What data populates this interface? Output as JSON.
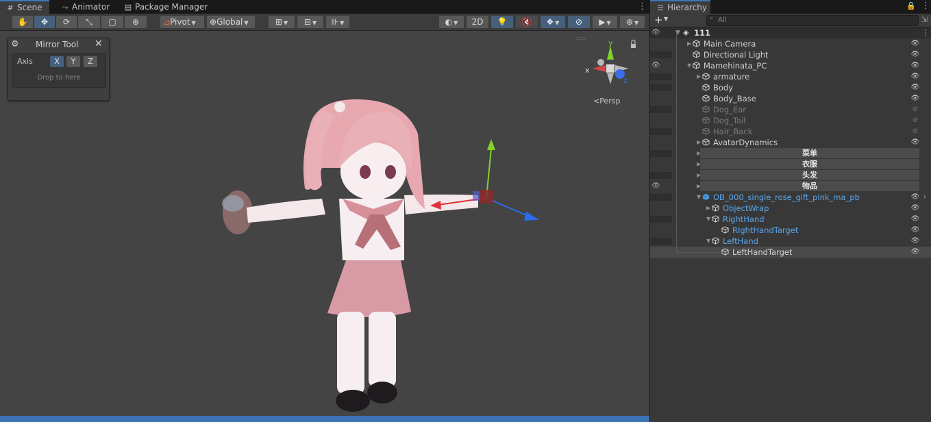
{
  "tabs": {
    "scene": "Scene",
    "animator": "Animator",
    "package_manager": "Package Manager",
    "hierarchy": "Hierarchy"
  },
  "toolbar": {
    "pivot": "Pivot",
    "global": "Global",
    "mode_2d": "2D"
  },
  "scene": {
    "persp_label": "Persp",
    "gizmo_axes": {
      "x": "x",
      "y": "y",
      "z": "z"
    }
  },
  "mirror_tool": {
    "title": "Mirror Tool",
    "axis_label": "Axis",
    "axes": [
      "X",
      "Y",
      "Z"
    ],
    "selected_axis": "X",
    "drop_hint": "Drop to here"
  },
  "hierarchy": {
    "search_placeholder": "All",
    "scene_name": "111",
    "items": [
      {
        "label": "Main Camera",
        "state": "normal",
        "visible": true
      },
      {
        "label": "Directional Light",
        "state": "normal",
        "visible": true
      },
      {
        "label": "Mamehinata_PC",
        "state": "normal",
        "visible": true
      },
      {
        "label": "armature",
        "state": "normal",
        "visible": true
      },
      {
        "label": "Body",
        "state": "normal",
        "visible": true
      },
      {
        "label": "Body_Base",
        "state": "normal",
        "visible": true
      },
      {
        "label": "Dog_Ear",
        "state": "disabled",
        "visible": false
      },
      {
        "label": "Dog_Tail",
        "state": "disabled",
        "visible": false
      },
      {
        "label": "Hair_Back",
        "state": "disabled",
        "visible": false
      },
      {
        "label": "AvatarDynamics",
        "state": "normal",
        "visible": true
      },
      {
        "label": "菜单",
        "state": "separator"
      },
      {
        "label": "衣服",
        "state": "separator"
      },
      {
        "label": "头发",
        "state": "separator"
      },
      {
        "label": "物品",
        "state": "separator"
      },
      {
        "label": "OB_000_single_rose_gift_pink_ma_pb",
        "state": "prefab",
        "visible": true
      },
      {
        "label": "ObjectWrap",
        "state": "prefab",
        "visible": true
      },
      {
        "label": "RightHand",
        "state": "prefab",
        "visible": true
      },
      {
        "label": "RIghtHandTarget",
        "state": "prefab",
        "visible": true
      },
      {
        "label": "LeftHand",
        "state": "prefab",
        "visible": true
      },
      {
        "label": "LeftHandTarget",
        "state": "selected",
        "visible": true
      }
    ]
  },
  "colors": {
    "accent": "#3d72b6",
    "prefab_text": "#5aa6ec",
    "gizmo_x": "#e0323c",
    "gizmo_y": "#7fd32a",
    "gizmo_z": "#2c6cf0"
  }
}
